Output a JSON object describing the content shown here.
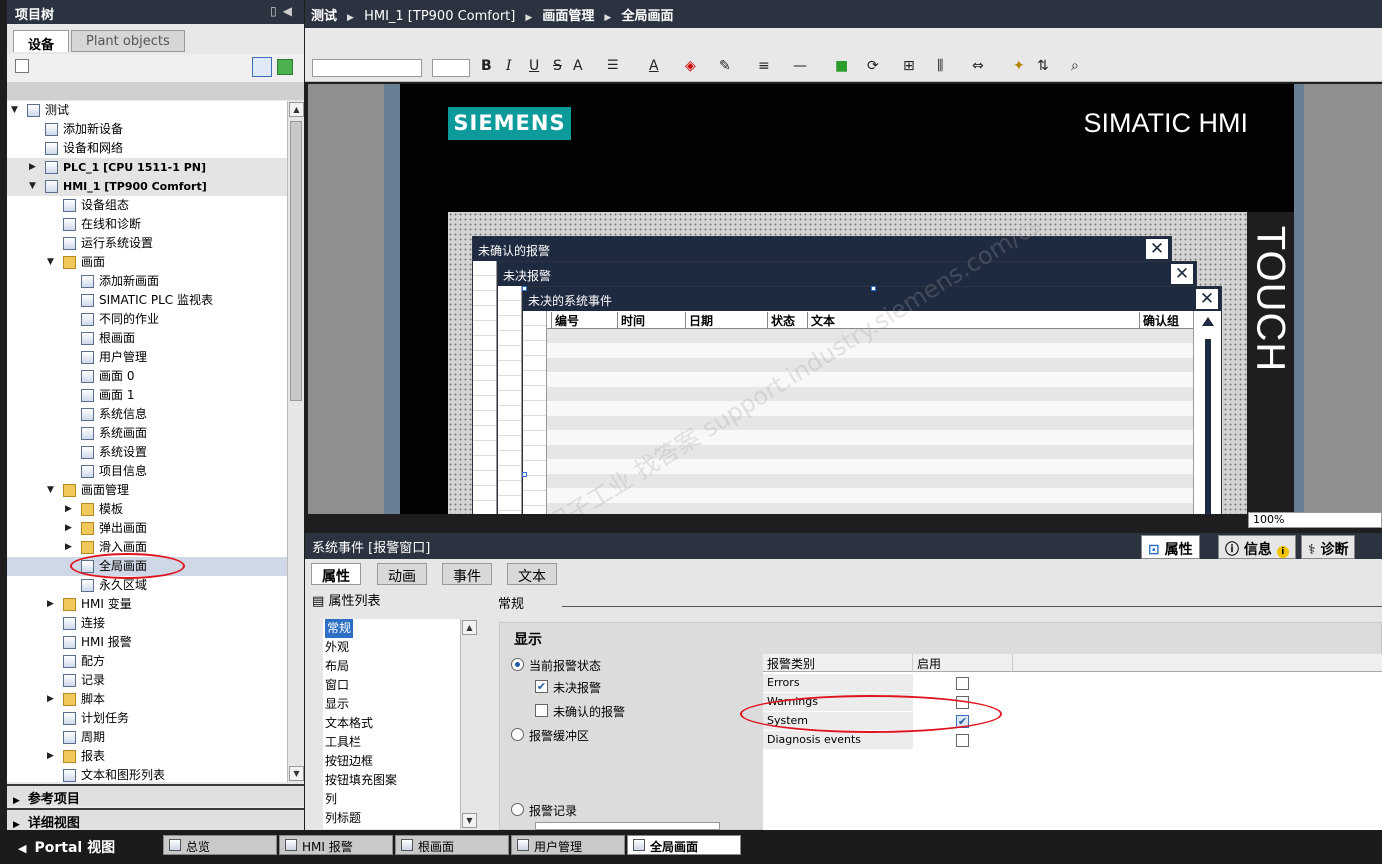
{
  "project_tree": {
    "title": "项目树",
    "tabs": [
      "设备",
      "Plant objects"
    ],
    "items": [
      {
        "label": "测试",
        "level": 0,
        "arrow": "down",
        "icon": "project-icon"
      },
      {
        "label": "添加新设备",
        "level": 1,
        "arrow": "",
        "icon": "add-device-icon"
      },
      {
        "label": "设备和网络",
        "level": 1,
        "arrow": "",
        "icon": "network-icon"
      },
      {
        "label": "PLC_1 [CPU 1511-1 PN]",
        "level": 1,
        "arrow": "right",
        "icon": "plc-icon",
        "bold": true,
        "shaded": true
      },
      {
        "label": "HMI_1 [TP900 Comfort]",
        "level": 1,
        "arrow": "down",
        "icon": "hmi-icon",
        "bold": true,
        "shaded": true
      },
      {
        "label": "设备组态",
        "level": 2,
        "arrow": "",
        "icon": "device-config-icon"
      },
      {
        "label": "在线和诊断",
        "level": 2,
        "arrow": "",
        "icon": "online-diag-icon"
      },
      {
        "label": "运行系统设置",
        "level": 2,
        "arrow": "",
        "icon": "runtime-settings-icon"
      },
      {
        "label": "画面",
        "level": 2,
        "arrow": "down",
        "icon": "folder-icon"
      },
      {
        "label": "添加新画面",
        "level": 3,
        "arrow": "",
        "icon": "add-screen-icon"
      },
      {
        "label": "SIMATIC PLC 监视表",
        "level": 3,
        "arrow": "",
        "icon": "screen-icon"
      },
      {
        "label": "不同的作业",
        "level": 3,
        "arrow": "",
        "icon": "screen-icon"
      },
      {
        "label": "根画面",
        "level": 3,
        "arrow": "",
        "icon": "root-screen-icon"
      },
      {
        "label": "用户管理",
        "level": 3,
        "arrow": "",
        "icon": "screen-icon"
      },
      {
        "label": "画面 0",
        "level": 3,
        "arrow": "",
        "icon": "screen-icon"
      },
      {
        "label": "画面 1",
        "level": 3,
        "arrow": "",
        "icon": "screen-icon"
      },
      {
        "label": "系统信息",
        "level": 3,
        "arrow": "",
        "icon": "screen-icon"
      },
      {
        "label": "系统画面",
        "level": 3,
        "arrow": "",
        "icon": "screen-icon"
      },
      {
        "label": "系统设置",
        "level": 3,
        "arrow": "",
        "icon": "screen-icon"
      },
      {
        "label": "项目信息",
        "level": 3,
        "arrow": "",
        "icon": "screen-icon"
      },
      {
        "label": "画面管理",
        "level": 2,
        "arrow": "down",
        "icon": "folder-icon"
      },
      {
        "label": "模板",
        "level": 3,
        "arrow": "right",
        "icon": "folder-icon"
      },
      {
        "label": "弹出画面",
        "level": 3,
        "arrow": "right",
        "icon": "folder-icon"
      },
      {
        "label": "滑入画面",
        "level": 3,
        "arrow": "right",
        "icon": "folder-icon"
      },
      {
        "label": "全局画面",
        "level": 3,
        "arrow": "",
        "icon": "global-screen-icon",
        "selected": true
      },
      {
        "label": "永久区域",
        "level": 3,
        "arrow": "",
        "icon": "screen-icon"
      },
      {
        "label": "HMI 变量",
        "level": 2,
        "arrow": "right",
        "icon": "folder-icon"
      },
      {
        "label": "连接",
        "level": 2,
        "arrow": "",
        "icon": "connection-icon"
      },
      {
        "label": "HMI 报警",
        "level": 2,
        "arrow": "",
        "icon": "alarm-icon"
      },
      {
        "label": "配方",
        "level": 2,
        "arrow": "",
        "icon": "recipe-icon"
      },
      {
        "label": "记录",
        "level": 2,
        "arrow": "",
        "icon": "log-icon"
      },
      {
        "label": "脚本",
        "level": 2,
        "arrow": "right",
        "icon": "folder-icon"
      },
      {
        "label": "计划任务",
        "level": 2,
        "arrow": "",
        "icon": "task-icon"
      },
      {
        "label": "周期",
        "level": 2,
        "arrow": "",
        "icon": "cycle-icon"
      },
      {
        "label": "报表",
        "level": 2,
        "arrow": "right",
        "icon": "folder-icon"
      },
      {
        "label": "文本和图形列表",
        "level": 2,
        "arrow": "",
        "icon": "list-icon"
      }
    ],
    "bottom_sections": [
      "参考项目",
      "详细视图"
    ]
  },
  "breadcrumb": [
    "测试",
    "HMI_1 [TP900 Comfort]",
    "画面管理",
    "全局画面"
  ],
  "toolbar": {
    "bold": "B",
    "italic": "I",
    "underline": "U",
    "strike": "S",
    "font_size_up": "A"
  },
  "hmi": {
    "brand": "SIEMENS",
    "product": "SIMATIC HMI",
    "touch": "TOUCH",
    "brand_color": "#0c9a9a"
  },
  "alarm_windows": {
    "unack_title": "未确认的报警",
    "pending_title": "未决报警",
    "system_title": "未决的系统事件",
    "columns": [
      "编号",
      "时间",
      "日期",
      "状态",
      "文本",
      "确认组"
    ]
  },
  "zoom": "100%",
  "watermark": "西门子工业  找答案  support.industry.siemens.com/cs",
  "inspector": {
    "title": "系统事件 [报警窗口]",
    "right_tabs": [
      "属性",
      "信息",
      "诊断"
    ],
    "tabs": [
      "属性",
      "动画",
      "事件",
      "文本"
    ],
    "property_list_label": "属性列表",
    "property_items": [
      "常规",
      "外观",
      "布局",
      "窗口",
      "显示",
      "文本格式",
      "工具栏",
      "按钮边框",
      "按钮填充图案",
      "列",
      "列标题"
    ],
    "section_general": "常规",
    "section_display": "显示",
    "options": {
      "current_state": "当前报警状态",
      "pending": "未决报警",
      "unacknowledged": "未确认的报警",
      "buffer": "报警缓冲区",
      "log": "报警记录"
    },
    "class_table": {
      "col_class": "报警类别",
      "col_enabled": "启用",
      "rows": [
        {
          "name": "Errors",
          "enabled": false
        },
        {
          "name": "Warnings",
          "enabled": false
        },
        {
          "name": "System",
          "enabled": true
        },
        {
          "name": "Diagnosis events",
          "enabled": false
        }
      ]
    }
  },
  "taskbar": {
    "portal_view": "Portal 视图",
    "items": [
      "总览",
      "HMI 报警",
      "根画面",
      "用户管理",
      "全局画面"
    ]
  }
}
